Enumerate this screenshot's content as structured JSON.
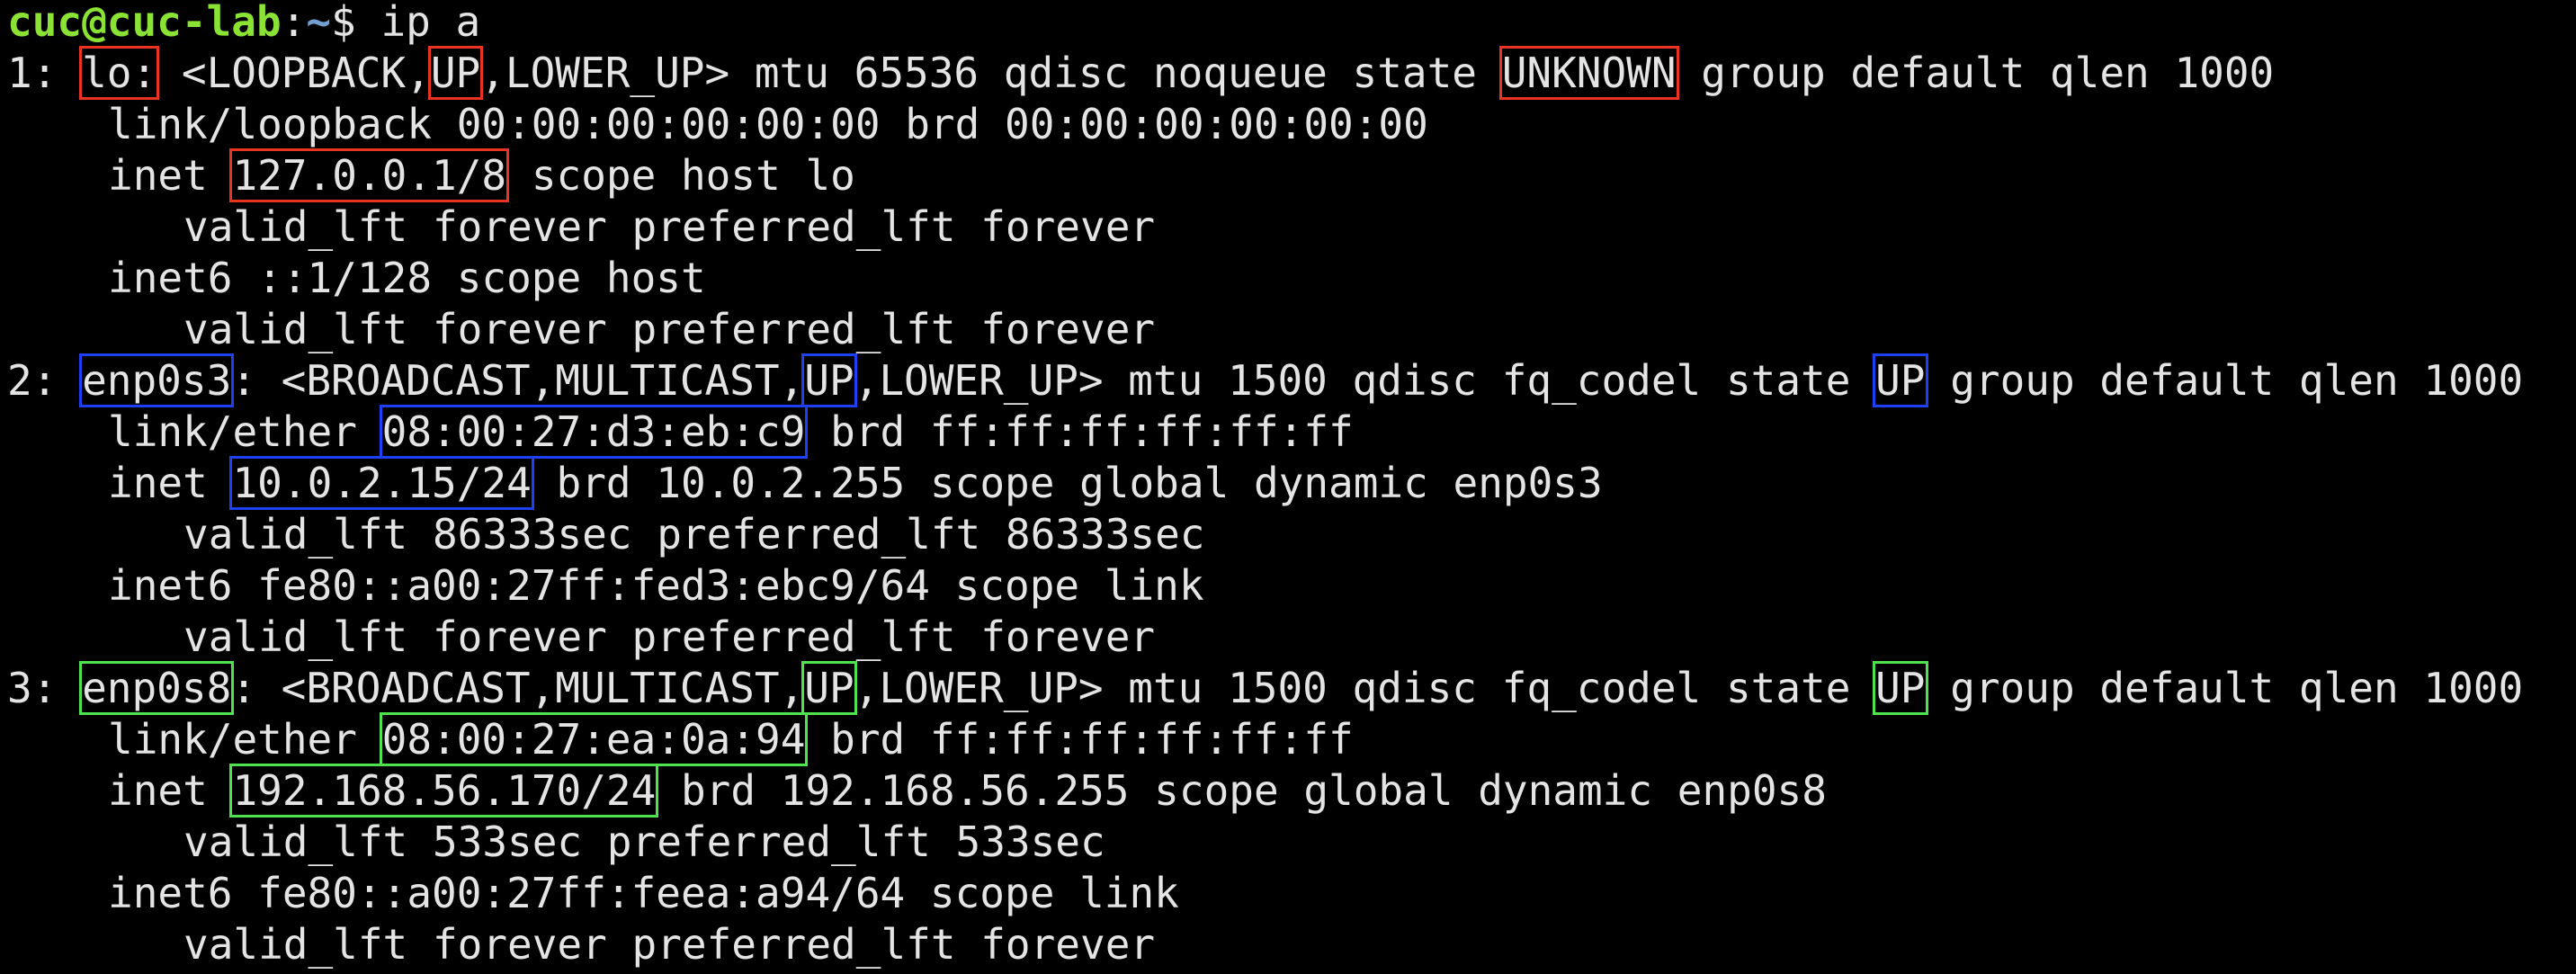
{
  "prompt": {
    "user_host": "cuc@cuc-lab",
    "sep": ":",
    "path": "~",
    "symbol": "$ ",
    "command": "ip a"
  },
  "highlight_colors": {
    "loopback": "#ea3323",
    "enp0s3": "#1f3ff2",
    "enp0s8": "#4fe24f"
  },
  "iface_lo": {
    "index": "1: ",
    "name": "lo:",
    "flags_pre": " <LOOPBACK,",
    "flag_up": "UP",
    "flags_post": ",LOWER_UP> mtu 65536 qdisc noqueue state ",
    "state": "UNKNOWN",
    "tail": " group default qlen 1000",
    "link": "link/loopback 00:00:00:00:00:00 brd 00:00:00:00:00:00",
    "inet_label": "inet ",
    "inet_addr": "127.0.0.1/8",
    "inet_rest": " scope host lo",
    "inet_lft": "valid_lft forever preferred_lft forever",
    "inet6": "inet6 ::1/128 scope host",
    "inet6_lft": "valid_lft forever preferred_lft forever"
  },
  "iface_enp0s3": {
    "index": "2: ",
    "name": "enp0s3",
    "flags_pre": ": <BROADCAST,MULTICAST,",
    "flag_up": "UP",
    "flags_post": ",LOWER_UP> mtu 1500 qdisc fq_codel state ",
    "state": "UP",
    "tail": " group default qlen 1000",
    "link_label": "link/ether ",
    "mac": "08:00:27:d3:eb:c9",
    "link_rest": " brd ff:ff:ff:ff:ff:ff",
    "inet_label": "inet ",
    "inet_addr": "10.0.2.15/24",
    "inet_rest": " brd 10.0.2.255 scope global dynamic enp0s3",
    "inet_lft": "valid_lft 86333sec preferred_lft 86333sec",
    "inet6": "inet6 fe80::a00:27ff:fed3:ebc9/64 scope link",
    "inet6_lft": "valid_lft forever preferred_lft forever"
  },
  "iface_enp0s8": {
    "index": "3: ",
    "name": "enp0s8",
    "flags_pre": ": <BROADCAST,MULTICAST,",
    "flag_up": "UP",
    "flags_post": ",LOWER_UP> mtu 1500 qdisc fq_codel state ",
    "state": "UP",
    "tail": " group default qlen 1000",
    "link_label": "link/ether ",
    "mac": "08:00:27:ea:0a:94",
    "link_rest": " brd ff:ff:ff:ff:ff:ff",
    "inet_label": "inet ",
    "inet_addr": "192.168.56.170/24",
    "inet_rest": " brd 192.168.56.255 scope global dynamic enp0s8",
    "inet_lft": "valid_lft 533sec preferred_lft 533sec",
    "inet6": "inet6 fe80::a00:27ff:feea:a94/64 scope link",
    "inet6_lft": "valid_lft forever preferred_lft forever"
  }
}
